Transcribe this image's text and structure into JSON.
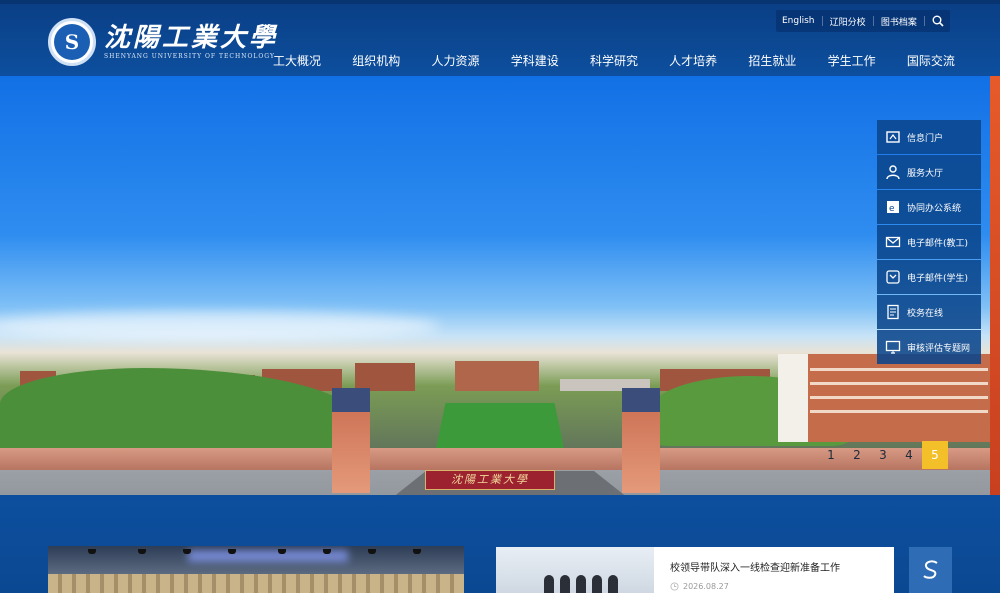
{
  "header": {
    "logo_cn": "沈陽工業大學",
    "logo_en": "SHENYANG UNIVERSITY OF TECHNOLOGY",
    "seal_letter": "S"
  },
  "topbar": {
    "links": [
      "English",
      "辽阳分校",
      "图书档案"
    ],
    "search_icon": "search-icon"
  },
  "nav": {
    "items": [
      "工大概况",
      "组织机构",
      "人力资源",
      "学科建设",
      "科学研究",
      "人才培养",
      "招生就业",
      "学生工作",
      "国际交流"
    ]
  },
  "hero": {
    "gate_sign": "沈陽工業大學"
  },
  "side_panel": {
    "items": [
      {
        "label": "信息门户",
        "icon": "portal-icon"
      },
      {
        "label": "服务大厅",
        "icon": "user-icon"
      },
      {
        "label": "协同办公系统",
        "icon": "office-icon"
      },
      {
        "label": "电子邮件(教工)",
        "icon": "mail-icon"
      },
      {
        "label": "电子邮件(学生)",
        "icon": "mail-box-icon"
      },
      {
        "label": "校务在线",
        "icon": "document-icon"
      },
      {
        "label": "审核评估专题网",
        "icon": "monitor-icon"
      }
    ]
  },
  "slider": {
    "pages": [
      "1",
      "2",
      "3",
      "4",
      "5"
    ],
    "active": "5"
  },
  "news": {
    "title": "校领导带队深入一线检查迎新准备工作",
    "date": "2026.08.27"
  },
  "colors": {
    "primary": "#0d4f9e",
    "accent": "#f4c02a",
    "side": "#0a468c"
  }
}
